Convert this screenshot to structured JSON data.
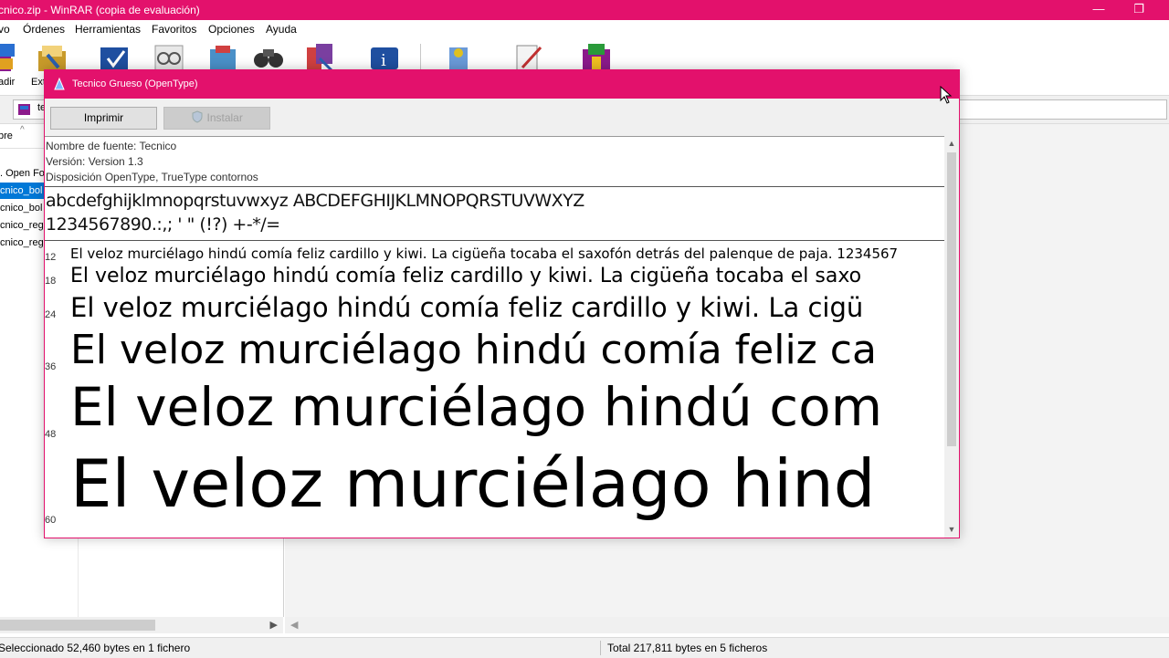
{
  "window": {
    "title": "cnico.zip - WinRAR (copia de evaluación)",
    "minimize_glyph": "—",
    "restore_glyph": "❐"
  },
  "menu": [
    "vo",
    "Órdenes",
    "Herramientas",
    "Favoritos",
    "Opciones",
    "Ayuda"
  ],
  "toolbar": {
    "labels": [
      "adir",
      "Ext"
    ],
    "icons": [
      "add-archive-icon",
      "extract-icon",
      "test-icon",
      "view-icon",
      "delete-icon",
      "find-icon",
      "wizard-icon",
      "info-icon",
      "virus-scan-icon",
      "comment-icon",
      "sfx-icon"
    ]
  },
  "address": {
    "fragment": "te"
  },
  "left_pane": {
    "column_header": "bre",
    "items": [
      ". Open Fo",
      "cnico_bol",
      "cnico_bol",
      "cnico_reg",
      "cnico_reg"
    ],
    "selected_index": 1
  },
  "status": {
    "selected": "Seleccionado 52,460 bytes en 1 fichero",
    "total": "Total 217,811 bytes en 5 ficheros"
  },
  "dialog": {
    "title": "Tecnico Grueso (OpenType)",
    "print_button": "Imprimir",
    "install_button": "Instalar",
    "font_name": "Nombre de fuente: Tecnico",
    "version": "Versión: Version 1.3",
    "layout": "Disposición OpenType, TrueType  contornos",
    "alphabet": "abcdefghijklmnopqrstuvwxyz ABCDEFGHIJKLMNOPQRSTUVWXYZ",
    "digits": "1234567890.:,; ' \" (!?) +-*/=",
    "samples": [
      {
        "size": "12",
        "text": "El veloz murciélago hindú comía feliz cardillo y kiwi. La cigüeña tocaba el saxofón detrás del palenque de paja. 1234567"
      },
      {
        "size": "18",
        "text": "El veloz murciélago hindú comía feliz cardillo y kiwi. La cigüeña tocaba el saxo"
      },
      {
        "size": "24",
        "text": "El veloz murciélago hindú comía feliz cardillo y kiwi. La cigü"
      },
      {
        "size": "36",
        "text": "El veloz murciélago hindú comía feliz ca"
      },
      {
        "size": "48",
        "text": "El veloz murciélago hindú com"
      },
      {
        "size": "60",
        "text": "El veloz murciélago hind"
      }
    ]
  },
  "colors": {
    "titlebar": "#e3116c",
    "selection": "#0078d7"
  }
}
